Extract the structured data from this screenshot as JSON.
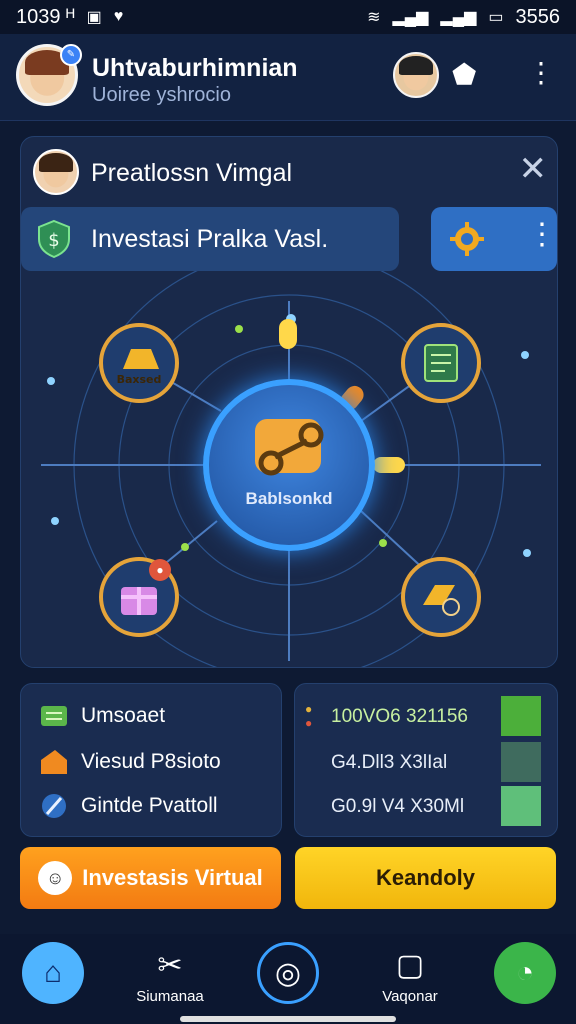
{
  "status_bar": {
    "time": "1039 ᴴ",
    "clock": "3556"
  },
  "header": {
    "title": "Uhtvaburhimnian",
    "subtitle": "Uoiree yshrocio"
  },
  "card": {
    "title": "Preatlossn Vimgal",
    "investment_label": "Investasi Pralka Vasl.",
    "hub_label": "Bablsonkd",
    "nodes": [
      {
        "name": "gold-bar-node",
        "label": "Baxsed"
      },
      {
        "name": "document-node",
        "label": ""
      },
      {
        "name": "gift-node",
        "label": ""
      },
      {
        "name": "gold-coin-node",
        "label": ""
      }
    ]
  },
  "panel_left": {
    "rows": [
      {
        "label": "Umsoaet"
      },
      {
        "label": "Viesud P8sioto"
      },
      {
        "label": "Gintde Pvattoll"
      }
    ]
  },
  "panel_right": {
    "rows": [
      {
        "label": "100VO6 321156",
        "color": "#4caf3a"
      },
      {
        "label": "G4.Dll3 X3lIal",
        "color": "#3f6b5e"
      },
      {
        "label": "G0.9l V4 X30Ml",
        "color": "#5fbf7a"
      }
    ]
  },
  "buttons": {
    "invest": "Investasis Virtual",
    "secondary": "Keandoly"
  },
  "nav": {
    "items": [
      {
        "label": ""
      },
      {
        "label": "Siumanaa"
      },
      {
        "label": ""
      },
      {
        "label": "Vaqonar"
      },
      {
        "label": ""
      }
    ]
  },
  "colors": {
    "accent": "#e5a43a",
    "primary": "#2f6fc4",
    "background": "#0e1a33"
  }
}
